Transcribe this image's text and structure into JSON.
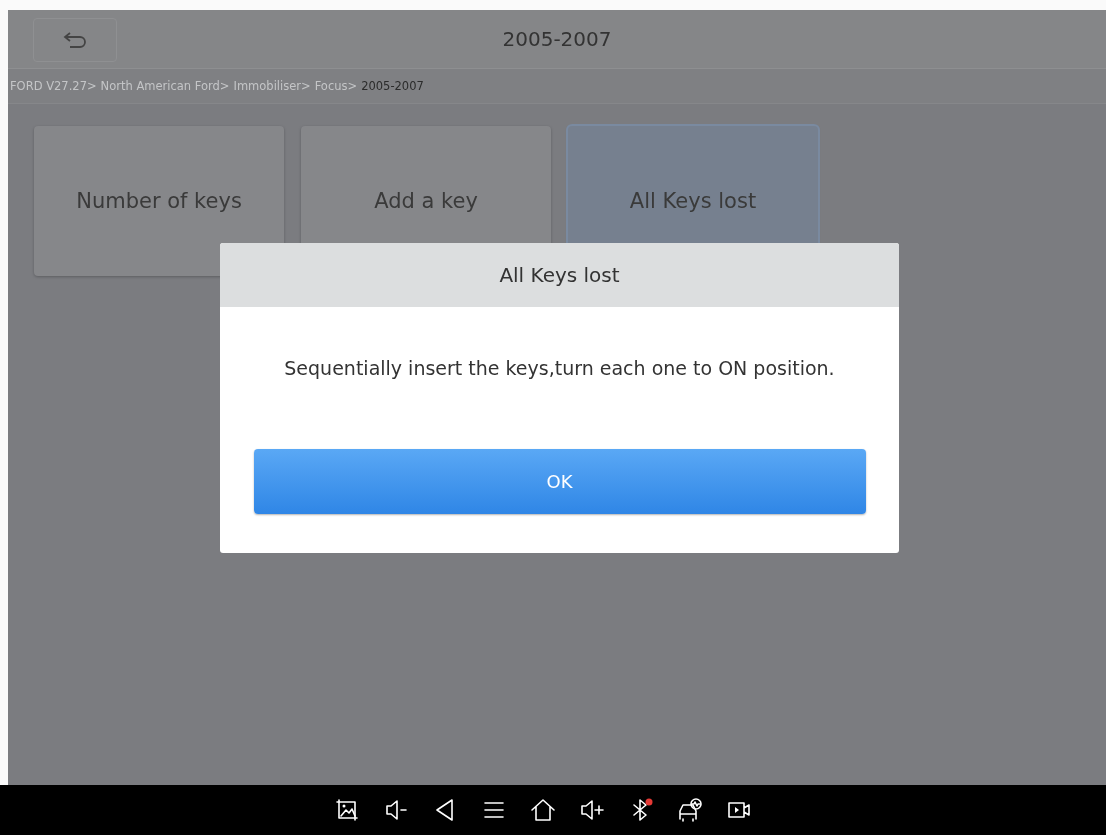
{
  "header": {
    "title": "2005-2007"
  },
  "breadcrumb": [
    {
      "label": "FORD V27.27>",
      "selected": false
    },
    {
      "label": "North American Ford>",
      "selected": false
    },
    {
      "label": "Immobiliser>",
      "selected": false
    },
    {
      "label": "Focus>",
      "selected": false
    },
    {
      "label": "2005-2007",
      "selected": true
    }
  ],
  "tiles": [
    {
      "label": "Number of keys",
      "selected": false
    },
    {
      "label": "Add a key",
      "selected": false
    },
    {
      "label": "All Keys lost",
      "selected": true
    }
  ],
  "dialog": {
    "title": "All Keys lost",
    "message": "Sequentially insert the keys,turn each one to ON position.",
    "button": "OK"
  }
}
